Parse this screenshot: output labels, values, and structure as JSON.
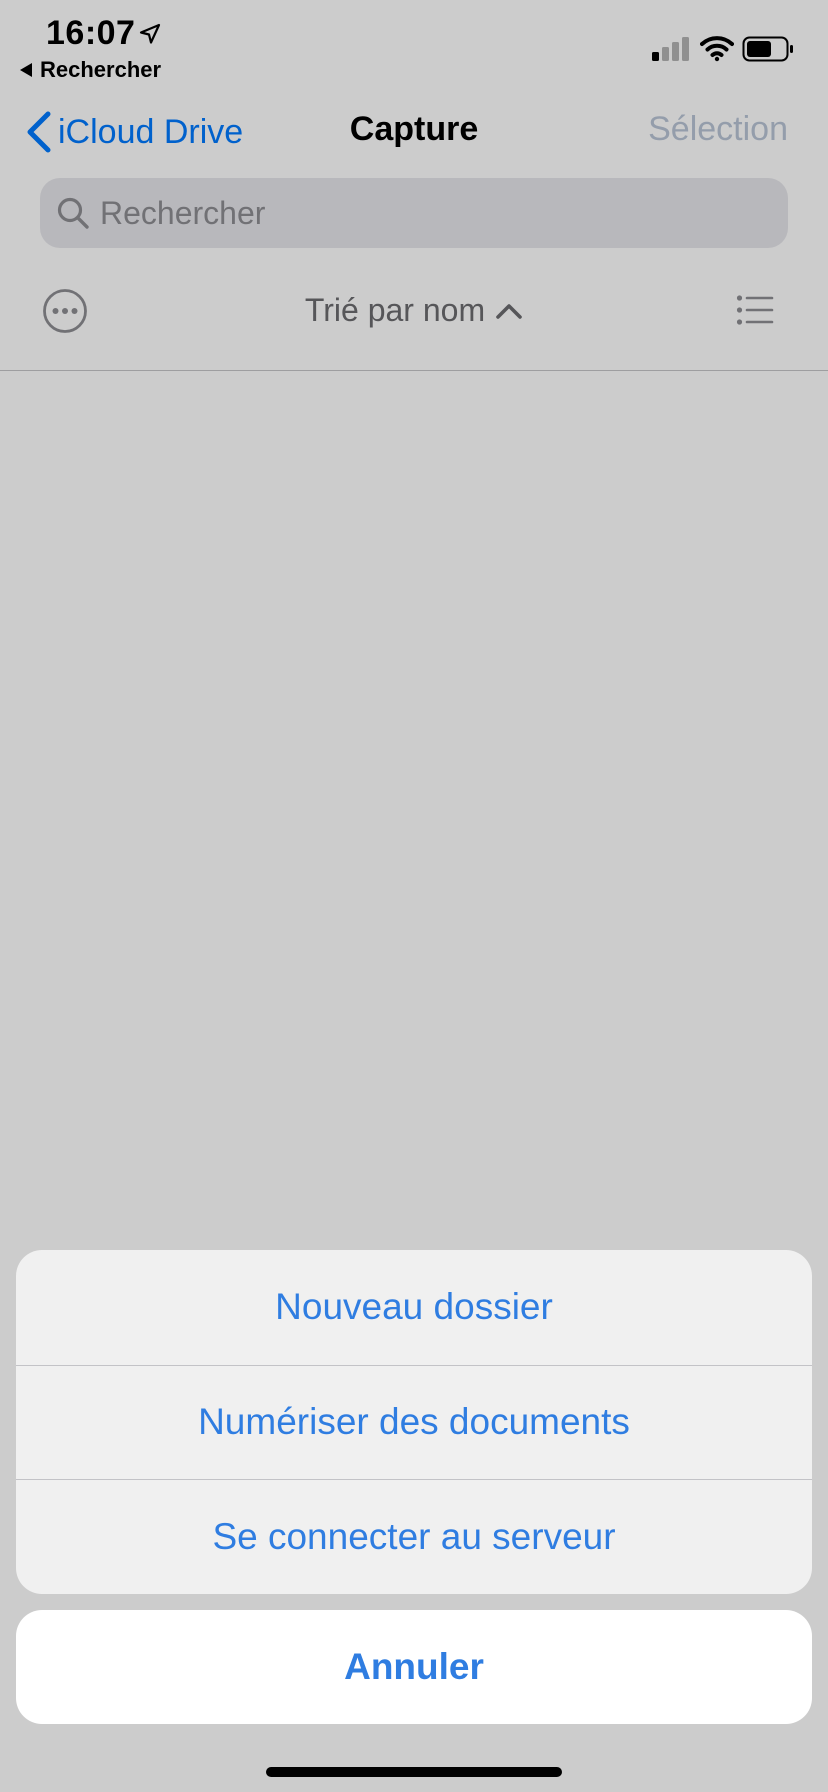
{
  "status_bar": {
    "time": "16:07",
    "back_app": "Rechercher",
    "icons": [
      "location-arrow-icon",
      "cellular-signal-icon",
      "wifi-icon",
      "battery-icon"
    ]
  },
  "nav": {
    "back_label": "iCloud Drive",
    "title": "Capture",
    "action_label": "Sélection"
  },
  "search": {
    "placeholder": "Rechercher",
    "value": ""
  },
  "toolbar": {
    "sort_label": "Trié par nom",
    "icons": [
      "ellipsis-circle-icon",
      "chevron-up-icon",
      "list-view-icon"
    ]
  },
  "action_sheet": {
    "items": [
      {
        "label": "Nouveau dossier"
      },
      {
        "label": "Numériser des documents"
      },
      {
        "label": "Se connecter au serveur"
      }
    ],
    "cancel_label": "Annuler"
  },
  "colors": {
    "accent": "#2f7de1",
    "ios_blue": "#007aff",
    "overlay": "rgba(0,0,0,0.2)",
    "sheet_bg": "#f0f0f0"
  }
}
